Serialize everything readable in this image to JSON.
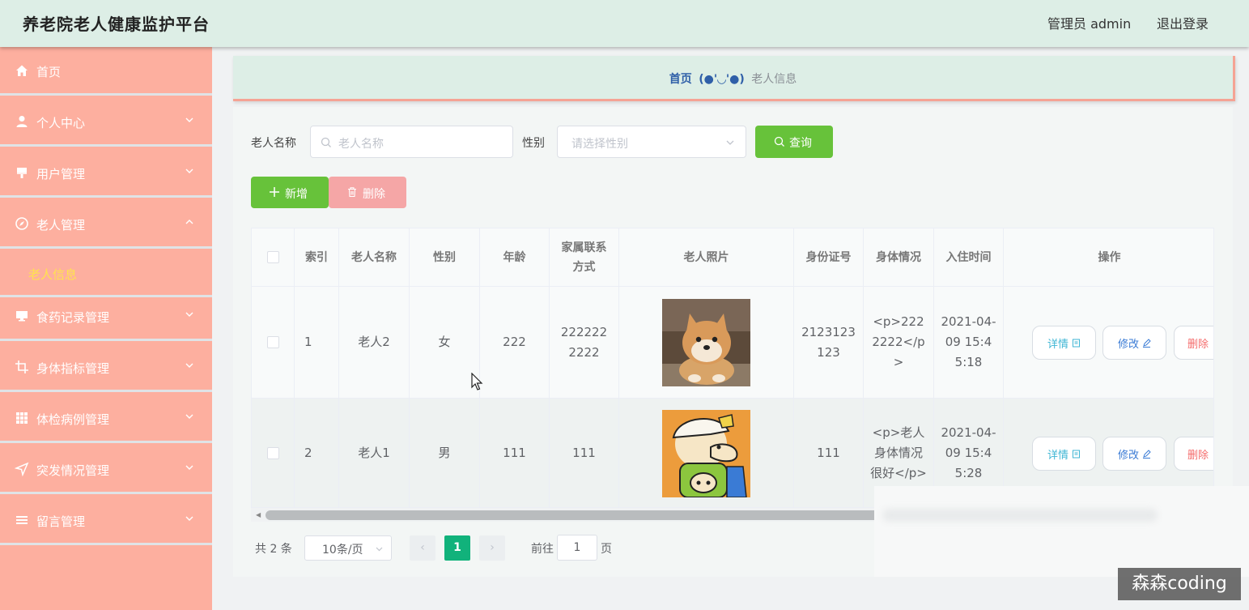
{
  "header": {
    "title": "养老院老人健康监护平台",
    "user_label": "管理员 admin",
    "logout_label": "退出登录"
  },
  "sidebar": {
    "items": [
      {
        "label": "首页",
        "icon": "home-icon",
        "expandable": false
      },
      {
        "label": "个人中心",
        "icon": "user-icon",
        "expandable": true
      },
      {
        "label": "用户管理",
        "icon": "brush-icon",
        "expandable": true
      },
      {
        "label": "老人管理",
        "icon": "compass-icon",
        "expandable": true,
        "expanded": true
      },
      {
        "label": "食药记录管理",
        "icon": "monitor-icon",
        "expandable": true
      },
      {
        "label": "身体指标管理",
        "icon": "crop-icon",
        "expandable": true
      },
      {
        "label": "体检病例管理",
        "icon": "grid-icon",
        "expandable": true
      },
      {
        "label": "突发情况管理",
        "icon": "send-icon",
        "expandable": true
      },
      {
        "label": "留言管理",
        "icon": "list-icon",
        "expandable": true
      }
    ],
    "sub_item": {
      "label": "老人信息",
      "color": "#ffe34d"
    }
  },
  "breadcrumb": {
    "home": "首页",
    "separator": "(●'◡'●)",
    "current": "老人信息"
  },
  "search": {
    "name_label": "老人名称",
    "name_placeholder": "老人名称",
    "gender_label": "性别",
    "gender_placeholder": "请选择性别",
    "query_label": "查询"
  },
  "actions": {
    "add_label": "新增",
    "delete_label": "删除"
  },
  "table": {
    "headers": [
      "索引",
      "老人名称",
      "性别",
      "年龄",
      "家属联系方式",
      "老人照片",
      "身份证号",
      "身体情况",
      "入住时间",
      "操作"
    ],
    "rows": [
      {
        "index": "1",
        "name": "老人2",
        "gender": "女",
        "age": "222",
        "contact": "2222222222",
        "photo": "shiba-inu-dog-photo",
        "id_number": "2123123123",
        "health": "<p>2222222</p>",
        "checkin": "2021-04-09 15:45:18"
      },
      {
        "index": "2",
        "name": "老人1",
        "gender": "男",
        "age": "111",
        "contact": "111",
        "photo": "cartoon-boy-photo",
        "id_number": "111",
        "health": "<p>老人身体情况很好</p>",
        "checkin": "2021-04-09 15:45:28"
      }
    ],
    "op_labels": {
      "detail": "详情",
      "edit": "修改",
      "delete": "删除"
    }
  },
  "pagination": {
    "total": "共 2 条",
    "page_size": "10条/页",
    "current_page": "1",
    "goto_label": "前往",
    "goto_value": "1",
    "unit": "页"
  },
  "watermark": "森森coding",
  "colors": {
    "header_bg": "#ddeee6",
    "sidebar_bg": "#fdaf9f",
    "primary_green": "#67c23a",
    "page_active": "#11b27b"
  }
}
